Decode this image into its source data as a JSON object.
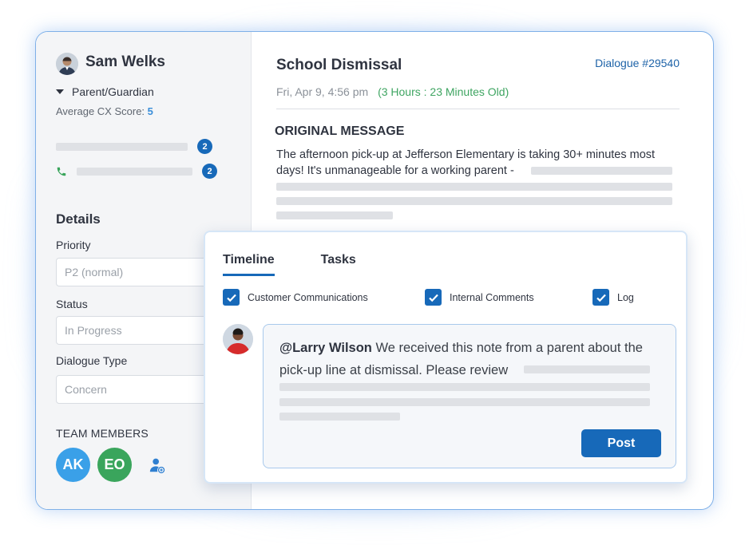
{
  "customer": {
    "name": "Sam Welks",
    "role": "Parent/Guardian",
    "cx_label": "Average CX Score:",
    "cx_score": "5",
    "channels": [
      {
        "icon": "message-icon",
        "count": "2"
      },
      {
        "icon": "phone-icon",
        "count": "2"
      }
    ]
  },
  "details": {
    "title": "Details",
    "priority_label": "Priority",
    "priority_value": "P2 (normal)",
    "status_label": "Status",
    "status_value": "In Progress",
    "type_label": "Dialogue Type",
    "type_value": "Concern"
  },
  "team": {
    "title": "TEAM MEMBERS",
    "members": [
      {
        "initials": "AK",
        "color": "#3aa0e8"
      },
      {
        "initials": "EO",
        "color": "#3aa55c"
      }
    ],
    "add_icon": "add-user-icon"
  },
  "dialogue": {
    "subject": "School Dismissal",
    "id": "Dialogue #29540",
    "date": "Fri, Apr 9, 4:56 pm",
    "age": "(3 Hours :  23 Minutes Old)",
    "original_title": "ORIGINAL MESSAGE",
    "original_text": "The afternoon pick-up at Jefferson Elementary is taking 30+ minutes most days! It's unmanageable for a working parent -"
  },
  "timeline": {
    "tabs": [
      "Timeline",
      "Tasks"
    ],
    "active_tab": "Timeline",
    "filters": [
      {
        "label": "Customer Communications",
        "checked": true
      },
      {
        "label": "Internal Comments",
        "checked": true
      },
      {
        "label": "Log",
        "checked": true
      }
    ],
    "comment": {
      "mention": "@Larry Wilson",
      "text": " We received this note from a parent about the pick-up line at dismissal. Please review"
    },
    "post_label": "Post"
  },
  "colors": {
    "accent": "#1769b9",
    "link": "#1e63a8",
    "success": "#3fa562",
    "border": "#7fb0e8"
  }
}
